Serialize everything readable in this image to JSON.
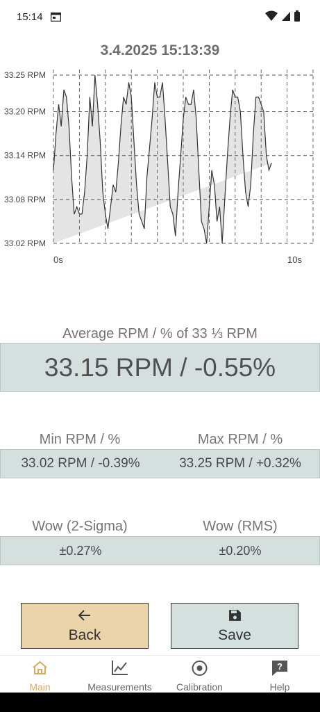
{
  "status_bar": {
    "time": "15:14"
  },
  "chart": {
    "timestamp": "3.4.2025 15:13:39"
  },
  "chart_data": {
    "type": "area",
    "y_ticks": [
      "33.25 RPM",
      "33.20 RPM",
      "33.14 RPM",
      "33.08 RPM",
      "33.02 RPM"
    ],
    "y_tick_values": [
      33.25,
      33.2,
      33.14,
      33.08,
      33.02
    ],
    "x_ticks": [
      "0s",
      "10s"
    ],
    "xlim": [
      0,
      10
    ],
    "ylim": [
      33.02,
      33.25
    ],
    "grid": true,
    "x": [
      0,
      0.1,
      0.2,
      0.3,
      0.4,
      0.5,
      0.6,
      0.7,
      0.8,
      0.9,
      1,
      1.1,
      1.2,
      1.3,
      1.4,
      1.5,
      1.6,
      1.7,
      1.8,
      1.9,
      2,
      2.1,
      2.2,
      2.3,
      2.4,
      2.5,
      2.6,
      2.7,
      2.8,
      2.9,
      3,
      3.1,
      3.2,
      3.3,
      3.4,
      3.5,
      3.6,
      3.7,
      3.8,
      3.9,
      4,
      4.1,
      4.2,
      4.3,
      4.4,
      4.5,
      4.6,
      4.7,
      4.8,
      4.9,
      5,
      5.1,
      5.2,
      5.3,
      5.4,
      5.5,
      5.6,
      5.7,
      5.8,
      5.9,
      6,
      6.1,
      6.2,
      6.3,
      6.4,
      6.5,
      6.6,
      6.7,
      6.8,
      6.9,
      7,
      7.1,
      7.2,
      7.3,
      7.4,
      7.5,
      7.6,
      7.7,
      7.8,
      7.9,
      8,
      8.1,
      8.2,
      8.3,
      8.4,
      8.5,
      8.6,
      8.7,
      8.8,
      8.9,
      9,
      9.1,
      9.2,
      9.3,
      9.4,
      9.5,
      9.6,
      9.7,
      9.8,
      9.9,
      10
    ],
    "values": [
      33.12,
      33.17,
      33.21,
      33.18,
      33.23,
      33.22,
      33.18,
      33.11,
      33.06,
      33.07,
      33.06,
      33.06,
      33.09,
      33.14,
      33.22,
      33.18,
      33.25,
      33.21,
      33.16,
      33.09,
      33.06,
      33.04,
      33.07,
      33.1,
      33.09,
      33.13,
      33.18,
      33.22,
      33.21,
      33.24,
      33.22,
      33.16,
      33.1,
      33.06,
      33.05,
      33.04,
      33.11,
      33.15,
      33.19,
      33.24,
      33.22,
      33.22,
      33.24,
      33.19,
      33.13,
      33.07,
      33.06,
      33.03,
      33.09,
      33.14,
      33.19,
      33.22,
      33.21,
      33.21,
      33.23,
      33.19,
      33.12,
      33.05,
      33.04,
      33.02,
      33.07,
      33.12,
      33.1,
      33.05,
      33.07,
      33.02,
      33.08,
      33.14,
      33.19,
      33.23,
      33.22,
      33.22,
      33.2,
      33.14,
      33.09,
      33.07,
      33.1,
      33.17,
      33.22,
      33.22,
      33.21,
      33.2,
      33.14,
      33.12,
      33.13
    ]
  },
  "average": {
    "label": "Average RPM / % of 33 ⅓ RPM",
    "value": "33.15 RPM / -0.55%"
  },
  "minmax": {
    "min_label": "Min RPM / %",
    "max_label": "Max RPM / %",
    "min_value": "33.02 RPM / -0.39%",
    "max_value": "33.25 RPM / +0.32%"
  },
  "wow": {
    "sigma_label": "Wow (2-Sigma)",
    "rms_label": "Wow (RMS)",
    "sigma_value": "±0.27%",
    "rms_value": "±0.20%"
  },
  "buttons": {
    "back_label": "Back",
    "save_label": "Save"
  },
  "nav": {
    "main": "Main",
    "measurements": "Measurements",
    "calibration": "Calibration",
    "help": "Help"
  },
  "colors": {
    "accent": "#d9aa5a",
    "back_button": "#ebd3aa",
    "panel": "#d5e0de",
    "chart_fill": "#e4e4e4"
  }
}
